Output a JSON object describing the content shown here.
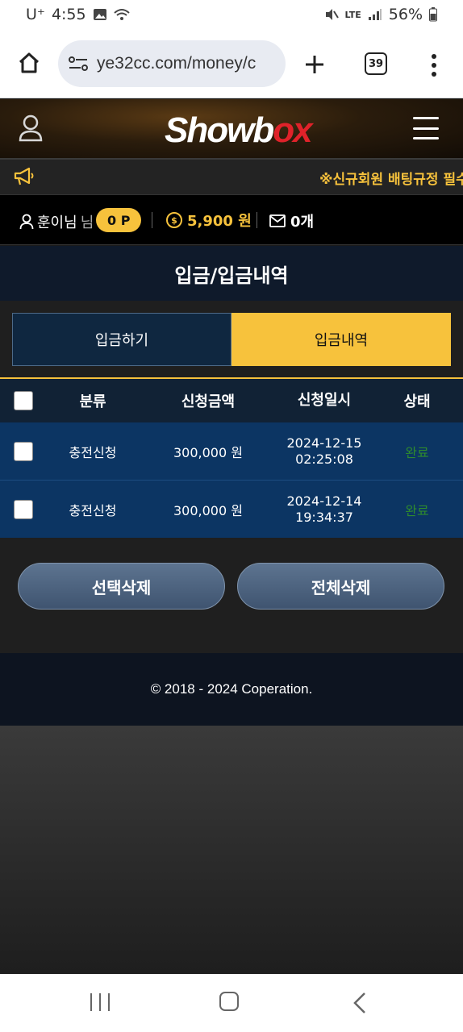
{
  "status_bar": {
    "carrier": "U⁺",
    "time": "4:55",
    "network": "LTE",
    "battery": "56%"
  },
  "browser": {
    "url": "ye32cc.com/money/c",
    "tab_count": "39"
  },
  "header": {
    "logo_text_a": "Showb",
    "logo_text_b": "ox"
  },
  "notice": {
    "text": "※신규회원 배팅규정 필수"
  },
  "user_info": {
    "username": "훈이님",
    "suffix": "님",
    "points": "0 P",
    "balance": "5,900 원",
    "messages": "0개"
  },
  "page": {
    "title": "입금/입금내역"
  },
  "tabs": [
    {
      "label": "입금하기",
      "active": false
    },
    {
      "label": "입금내역",
      "active": true
    }
  ],
  "table": {
    "headers": {
      "category": "분류",
      "amount": "신청금액",
      "date": "신청일시",
      "status": "상태"
    },
    "rows": [
      {
        "category": "충전신청",
        "amount": "300,000 원",
        "date": "2024-12-15",
        "time": "02:25:08",
        "status": "완료"
      },
      {
        "category": "충전신청",
        "amount": "300,000 원",
        "date": "2024-12-14",
        "time": "19:34:37",
        "status": "완료"
      }
    ]
  },
  "buttons": {
    "delete_selected": "선택삭제",
    "delete_all": "전체삭제"
  },
  "footer": {
    "copyright": "© 2018 - 2024 Coperation."
  },
  "colors": {
    "accent": "#f7c23c",
    "table_row": "#0c3563",
    "status_done": "#2e8a2e"
  }
}
